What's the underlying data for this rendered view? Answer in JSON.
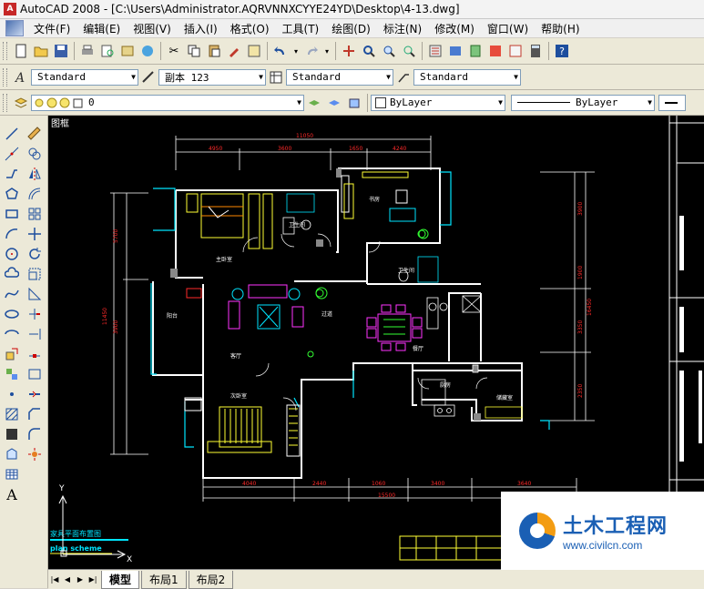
{
  "window": {
    "title": "AutoCAD 2008 - [C:\\Users\\Administrator.AQRVNNXCYYE24YD\\Desktop\\4-13.dwg]"
  },
  "menu": {
    "items": [
      "文件(F)",
      "编辑(E)",
      "视图(V)",
      "插入(I)",
      "格式(O)",
      "工具(T)",
      "绘图(D)",
      "标注(N)",
      "修改(M)",
      "窗口(W)",
      "帮助(H)"
    ]
  },
  "styles": {
    "text_style": "Standard",
    "dim_style": "副本 123",
    "table_style": "Standard",
    "multileader_style": "Standard"
  },
  "layers": {
    "current_layer": "0",
    "color": "ByLayer",
    "linetype": "ByLayer"
  },
  "canvas": {
    "viewport_label": "图框",
    "drawing_title": "家具平面布置图",
    "drawing_subtitle": "plan scheme",
    "axis_y": "Y",
    "axis_x": "X"
  },
  "tabs": {
    "items": [
      "模型",
      "布局1",
      "布局2"
    ],
    "active": 0
  },
  "watermark": {
    "title": "土木工程网",
    "url": "www.civilcn.com"
  },
  "colors": {
    "canvas_bg": "#000000",
    "wall": "#ffffff",
    "dimension": "#ff2a2a",
    "furniture": "#ffff33",
    "cyan": "#00e5ff",
    "magenta": "#ff33ff"
  }
}
